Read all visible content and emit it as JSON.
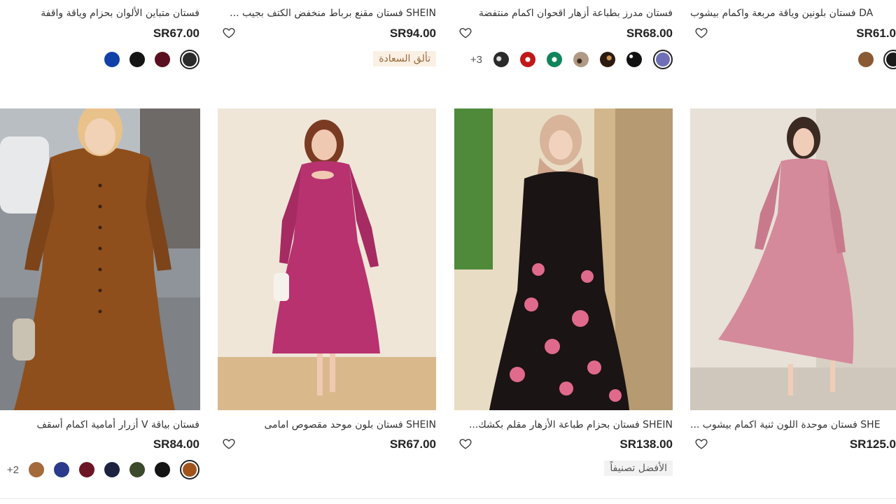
{
  "colors": {
    "happy_badge_bg": "#fbf0e4",
    "best_badge_bg": "#f2f2f2"
  },
  "top_row": [
    {
      "title": "SHEIN فستان مقنع برباط منخفض الكتف بجيب ...",
      "price": "SR94.00",
      "badge": "تألق السعادة",
      "swatches": []
    },
    {
      "title": "فستان متباين الألوان بحزام وياقة واقفة",
      "price": "SR67.00",
      "swatches": [
        "#2b2b2b",
        "#5a1020",
        "#141414",
        "#1041a8"
      ]
    },
    {
      "title": "فستان مدرز بطباعة أزهار اقحوان اكمام منتفضة",
      "price": "SR68.00",
      "swatches": [
        "#6f6fb8",
        "#111111",
        "#4a2f1e",
        "#7a6a5a",
        "#10855a",
        "#c01818",
        "#2a2a2a"
      ],
      "more": "+3"
    },
    {
      "title": "DA فستان بلونين وياقة مربعة واكمام بيشوب",
      "price": "SR61.0",
      "swatches": [
        "#1a1a1a",
        "#8a5a35"
      ]
    }
  ],
  "bottom_row": [
    {
      "title": "فستان بياقة V أزرار أمامية اكمام أسقف",
      "price": "SR84.00",
      "swatches": [
        "#a3541d",
        "#141414",
        "#3b4a2a",
        "#1b2340",
        "#6b1624",
        "#2a3a8c",
        "#a36a3c"
      ],
      "more": "+2"
    },
    {
      "title": "SHEIN فستان بلون موحد مقصوص امامى",
      "price": "SR67.00",
      "swatches": []
    },
    {
      "title": "SHEIN فستان بحزام طباعة الأزهار مقلم بكشك...",
      "price": "SR138.00",
      "badge": "الأفضل تصنيفاً",
      "swatches": []
    },
    {
      "title": "SHE فستان موحدة اللون ثنية اكمام بيشوب ...",
      "price": "SR125.0",
      "swatches": []
    }
  ]
}
